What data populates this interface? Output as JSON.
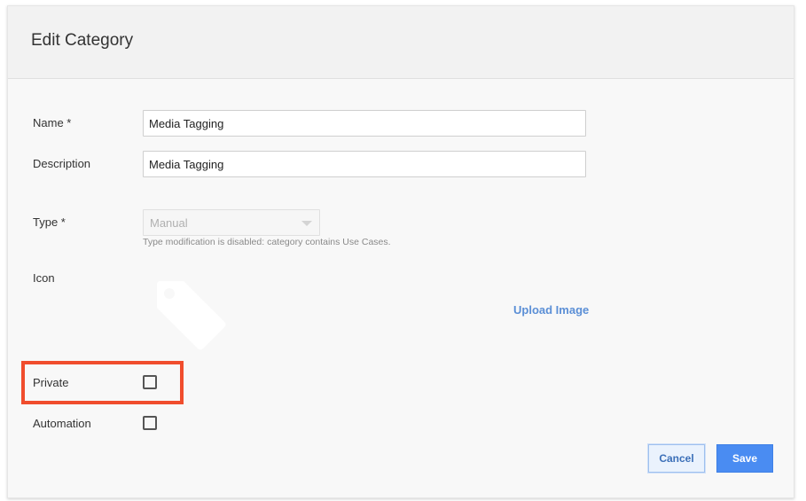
{
  "dialog": {
    "title": "Edit Category"
  },
  "form": {
    "name": {
      "label": "Name *",
      "value": "Media Tagging"
    },
    "description": {
      "label": "Description",
      "value": "Media Tagging"
    },
    "type": {
      "label": "Type *",
      "value": "Manual",
      "hint": "Type modification is disabled: category contains Use Cases."
    },
    "icon": {
      "label": "Icon",
      "upload_label": "Upload Image",
      "icon_name": "tag-icon"
    },
    "private": {
      "label": "Private",
      "checked": false
    },
    "automation": {
      "label": "Automation",
      "checked": false
    }
  },
  "actions": {
    "cancel_label": "Cancel",
    "save_label": "Save"
  },
  "colors": {
    "accent": "#4a8cf2",
    "link": "#5b8fd6",
    "highlight": "#f04d2d"
  }
}
